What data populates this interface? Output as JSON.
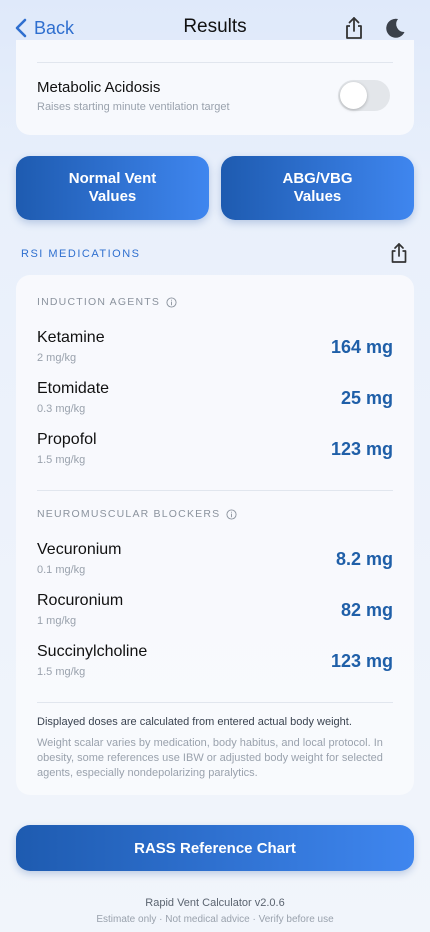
{
  "header": {
    "back_label": "Back",
    "title": "Results",
    "share_icon": "share-icon",
    "theme_icon": "moon-icon"
  },
  "options": {
    "toggle_title": "Metabolic Acidosis",
    "toggle_subtitle": "Raises starting minute ventilation target",
    "toggle_on": false
  },
  "buttons": {
    "normal_vent": "Normal Vent Values",
    "abg_vbg": "ABG/VBG Values",
    "rass": "RASS Reference Chart"
  },
  "rsi": {
    "section_label": "RSI MEDICATIONS",
    "induction_label": "INDUCTION AGENTS",
    "induction": [
      {
        "name": "Ketamine",
        "dose": "2 mg/kg",
        "value": "164 mg"
      },
      {
        "name": "Etomidate",
        "dose": "0.3 mg/kg",
        "value": "25 mg"
      },
      {
        "name": "Propofol",
        "dose": "1.5 mg/kg",
        "value": "123 mg"
      }
    ],
    "blockers_label": "NEUROMUSCULAR BLOCKERS",
    "blockers": [
      {
        "name": "Vecuronium",
        "dose": "0.1 mg/kg",
        "value": "8.2 mg"
      },
      {
        "name": "Rocuronium",
        "dose": "1 mg/kg",
        "value": "82 mg"
      },
      {
        "name": "Succinylcholine",
        "dose": "1.5 mg/kg",
        "value": "123 mg"
      }
    ],
    "note_main": "Displayed doses are calculated from entered actual body weight.",
    "note_sub": "Weight scalar varies by medication, body habitus, and local protocol. In obesity, some references use IBW or adjusted body weight for selected agents, especially nondepolarizing paralytics."
  },
  "footer": {
    "version": "Rapid Vent Calculator v2.0.6",
    "disclaimer": "Estimate only · Not medical advice · Verify before use"
  },
  "colors": {
    "accent": "#2f6fcf",
    "value_blue": "#1f5fa8",
    "button_gradient_start": "#1e5bb0",
    "button_gradient_end": "#3f86ef"
  }
}
